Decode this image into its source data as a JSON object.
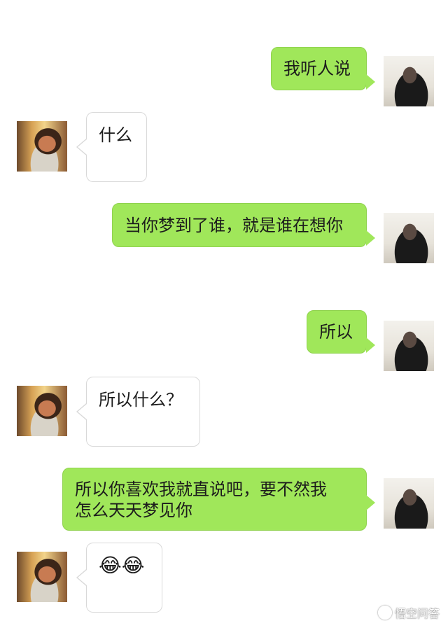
{
  "messages": [
    {
      "side": "sent",
      "text": "我听人说"
    },
    {
      "side": "recv",
      "text": "什么"
    },
    {
      "side": "sent",
      "text": "当你梦到了谁，就是谁在想你"
    },
    {
      "side": "sent",
      "text": "所以"
    },
    {
      "side": "recv",
      "text": "所以什么？"
    },
    {
      "side": "sent",
      "line1": "所以你喜欢我就直说吧，要不然我",
      "line2": "怎么天天梦见你"
    },
    {
      "side": "recv",
      "text": "😂😂"
    }
  ],
  "watermark": {
    "text": "悟空问答"
  },
  "colors": {
    "sent_bubble": "#a0e75a",
    "recv_bubble": "#ffffff"
  },
  "icons": {
    "watermark": "wukong-logo-icon"
  }
}
